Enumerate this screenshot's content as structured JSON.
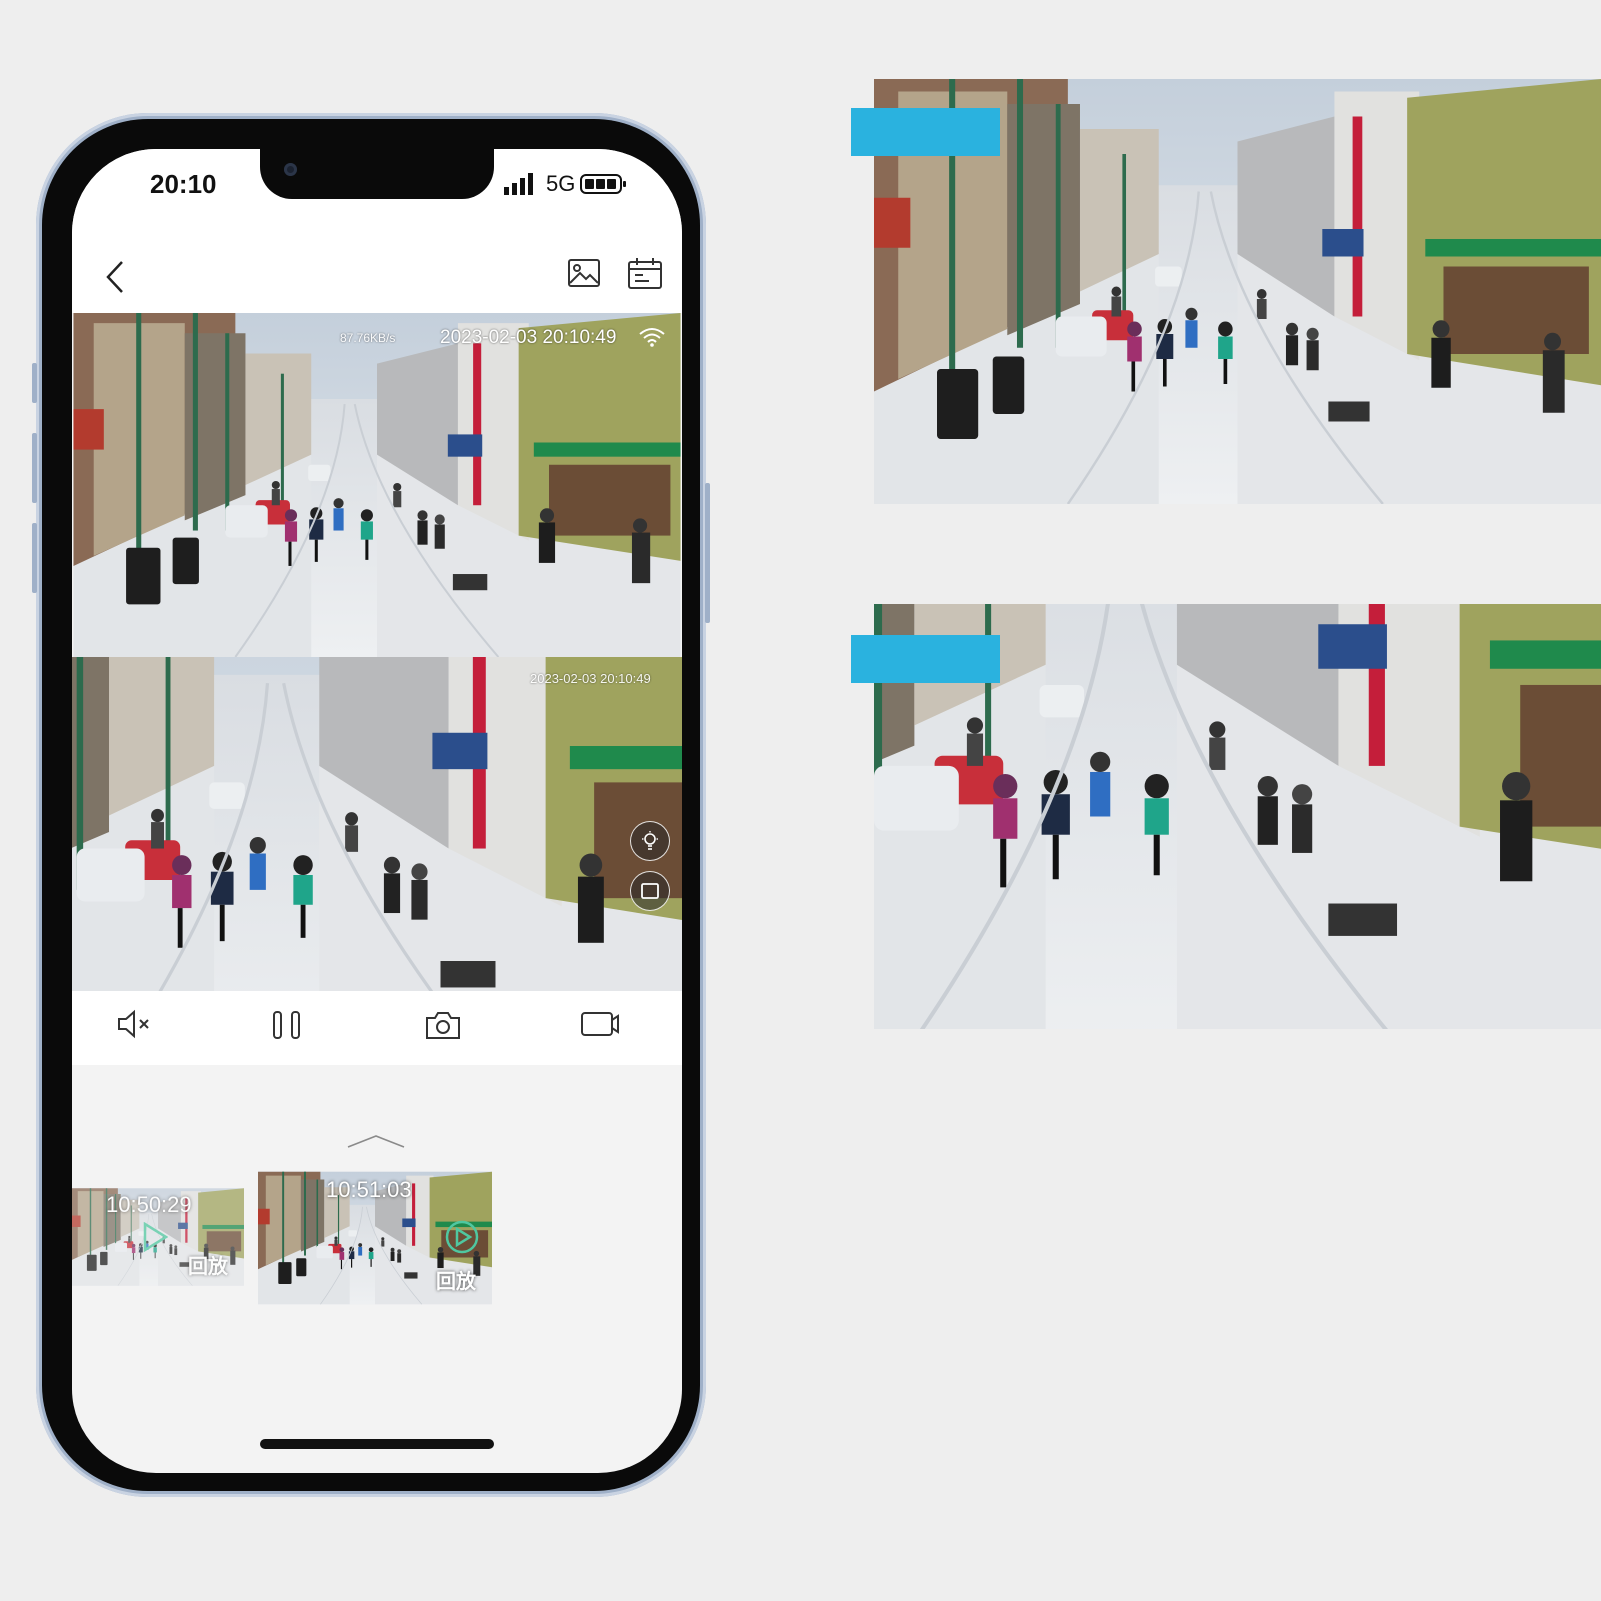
{
  "phone": {
    "status": {
      "time": "20:10",
      "network": "5G"
    },
    "live_view": {
      "bitrate": "87.76KB/s",
      "timestamp_main": "2023-02-03  20:10:49",
      "timestamp_secondary": "2023-02-03  20:10:49"
    },
    "controls": [
      "mute-icon",
      "pause-icon",
      "snapshot-icon",
      "record-icon"
    ],
    "recordings": [
      {
        "time": "10:50:29",
        "label": "回放"
      },
      {
        "time": "10:51:03",
        "label": "回放"
      }
    ]
  },
  "frames": [
    {
      "name": "wide-view"
    },
    {
      "name": "zoom-view"
    }
  ],
  "colors": {
    "accent": "#2ab2df",
    "background": "#eeeeee",
    "phone_frame": "#9fb0c8"
  }
}
